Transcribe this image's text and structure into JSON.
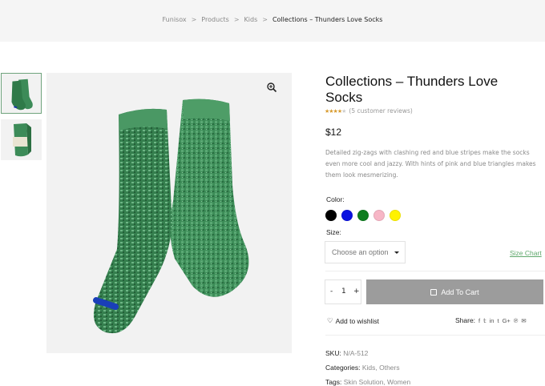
{
  "breadcrumb": {
    "items": [
      "Funisox",
      "Products",
      "Kids"
    ],
    "separator": ">",
    "current": "Collections – Thunders Love Socks"
  },
  "gallery": {
    "thumbnails": [
      "green-sock-thumbnail",
      "packaged-sock-thumbnail"
    ],
    "zoom_icon": "magnifier-plus-icon"
  },
  "product": {
    "title": "Collections – Thunders Love Socks",
    "rating": {
      "stars": 4,
      "max": 5,
      "reviews_text": "(5 customer reviews)"
    },
    "price": "$12",
    "description": "Detailed zig-zags with clashing red and blue stripes make the socks even more cool and jazzy. With hints of pink and blue triangles makes them look mesmerizing."
  },
  "options": {
    "color_label": "Color:",
    "colors": [
      "#000000",
      "#0a12e0",
      "#0e7d1f",
      "#f7b6c6",
      "#fff200"
    ],
    "size_label": "Size:",
    "size_placeholder": "Choose an option",
    "size_chart_link": "Size Chart"
  },
  "cart": {
    "qty_minus": "-",
    "qty_value": "1",
    "qty_plus": "+",
    "add_to_cart": "Add To Cart"
  },
  "wishlist": {
    "label": "Add to wishlist"
  },
  "share": {
    "label": "Share:",
    "icons": [
      "f",
      "𝕥",
      "in",
      "t",
      "G+",
      "℗",
      "✉"
    ]
  },
  "meta": {
    "sku_label": "SKU:",
    "sku_value": "N/A-512",
    "categories_label": "Categories:",
    "categories_value": "Kids, Others",
    "tags_label": "Tags:",
    "tags_value": "Skin Solution, Women"
  }
}
